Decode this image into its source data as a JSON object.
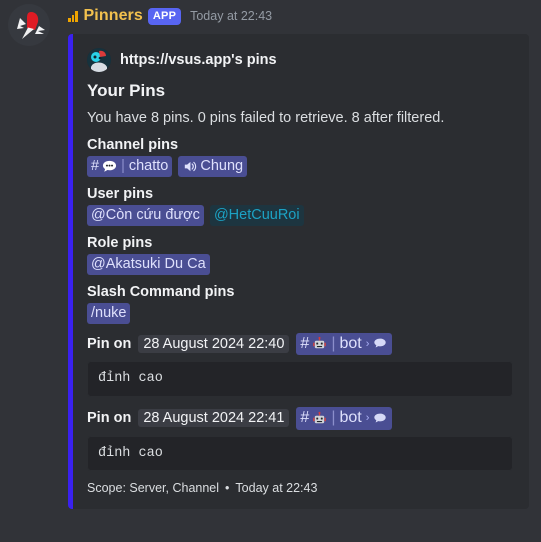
{
  "message": {
    "author_name": "Pinners",
    "app_badge": "APP",
    "timestamp": "Today at 22:43",
    "avatar_icon": "red-pushpin-avatar",
    "status_icon": "signal-bars-icon"
  },
  "embed": {
    "accent_color": "#3a21f0",
    "author": {
      "name": "https://vsus.app's pins",
      "avatar_icon": "vsus-app-avatar"
    },
    "title": "Your Pins",
    "description": "You have 8 pins. 0 pins failed to retrieve. 8 after filtered.",
    "fields": [
      {
        "name": "Channel pins",
        "mentions": [
          {
            "style": "blurple",
            "hash": "#",
            "emoji": "speech-balloon-emoji",
            "separator": "|",
            "label": "chatto"
          },
          {
            "style": "blurple",
            "icon": "speaker-icon",
            "label": "Chung"
          }
        ]
      },
      {
        "name": "User pins",
        "mentions": [
          {
            "style": "blurple",
            "label": "@Còn cứu được"
          },
          {
            "style": "teal",
            "label": "@HetCuuRoi"
          }
        ]
      },
      {
        "name": "Role pins",
        "mentions": [
          {
            "style": "blurple",
            "label": "@Akatsuki Du Ca"
          }
        ]
      },
      {
        "name": "Slash Command pins",
        "mentions": [
          {
            "style": "blurple",
            "label": "/nuke"
          }
        ]
      }
    ],
    "pins": [
      {
        "label": "Pin on",
        "timestamp": "28 August 2024 22:40",
        "channel": {
          "hash": "#",
          "emoji": "robot-emoji",
          "separator": "|",
          "label": "bot",
          "caret": "›",
          "thread_icon": "speech-balloon-icon"
        },
        "content": "đỉnh cao"
      },
      {
        "label": "Pin on",
        "timestamp": "28 August 2024 22:41",
        "channel": {
          "hash": "#",
          "emoji": "robot-emoji",
          "separator": "|",
          "label": "bot",
          "caret": "›",
          "thread_icon": "speech-balloon-icon"
        },
        "content": "đỉnh cao"
      }
    ],
    "footer": {
      "scope": "Scope: Server, Channel",
      "separator": "•",
      "timestamp": "Today at 22:43"
    }
  },
  "colors": {
    "page_bg": "#313338",
    "embed_bg": "#2b2d31",
    "accent": "#3a21f0",
    "app_badge": "#5865f2",
    "author_name": "#f2c14e",
    "mention_blurple_bg": "#4a4e93",
    "mention_teal_text": "#1ca2c4",
    "codeblock_bg": "#232428"
  }
}
